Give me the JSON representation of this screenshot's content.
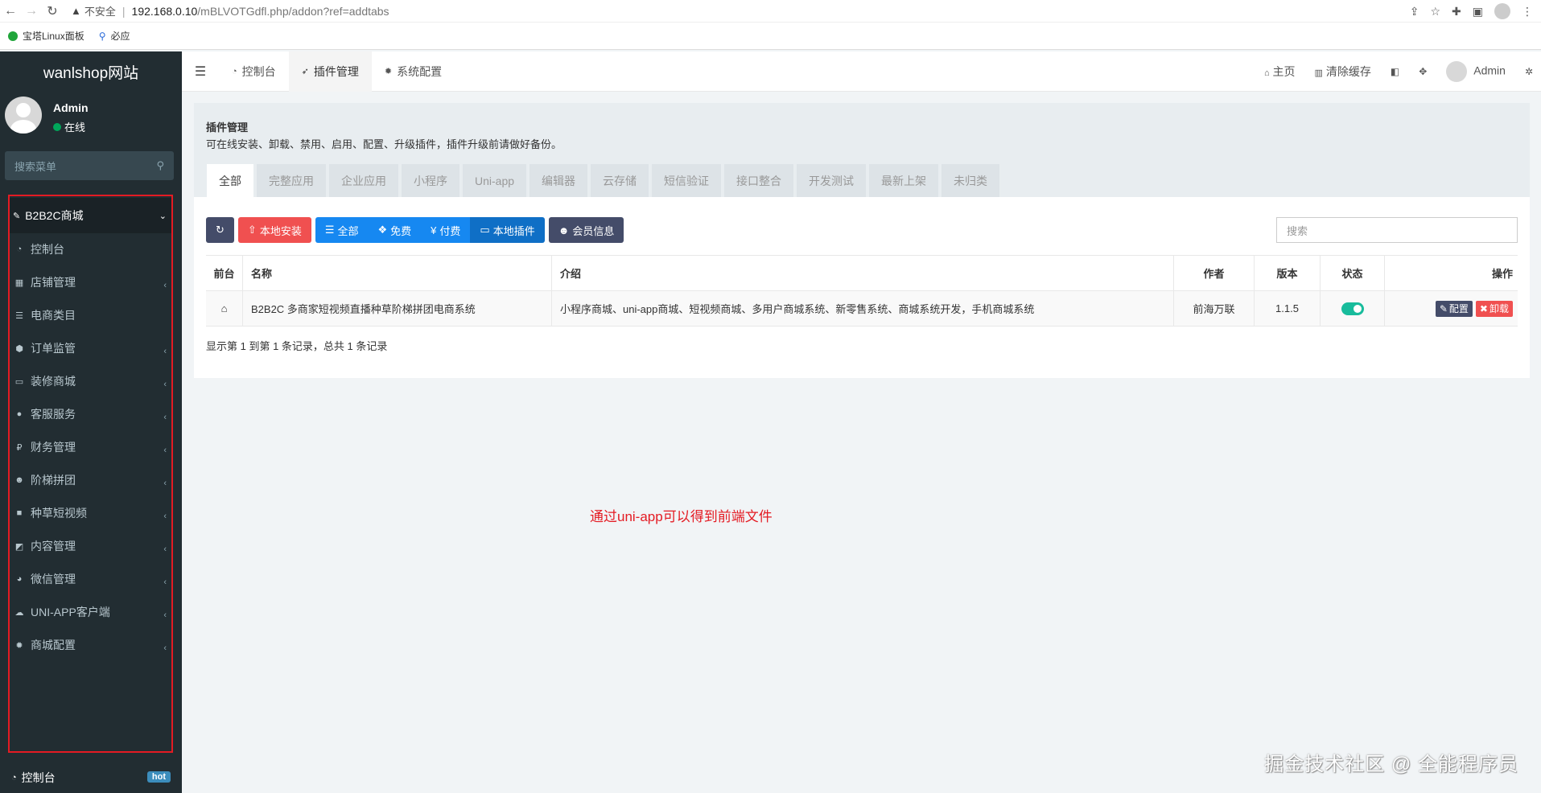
{
  "browser": {
    "back_icon": "←",
    "forward_icon": "→",
    "reload_icon": "↻",
    "warning_icon": "▲",
    "insecure_label": "不安全",
    "url_host": "192.168.0.10",
    "url_path": "/mBLVOTGdfl.php/addon?ref=addtabs",
    "bookmarks": [
      {
        "label": "宝塔Linux面板"
      },
      {
        "label": "必应"
      }
    ]
  },
  "sidebar": {
    "logo": "wanlshop网站",
    "user_name": "Admin",
    "user_status": "在线",
    "search_placeholder": "搜索菜单",
    "group_label": "B2B2C商城",
    "items": [
      {
        "label": "控制台"
      },
      {
        "label": "店铺管理"
      },
      {
        "label": "电商类目"
      },
      {
        "label": "订单监管"
      },
      {
        "label": "装修商城"
      },
      {
        "label": "客服服务"
      },
      {
        "label": "财务管理"
      },
      {
        "label": "阶梯拼团"
      },
      {
        "label": "种草短视频"
      },
      {
        "label": "内容管理"
      },
      {
        "label": "微信管理"
      },
      {
        "label": "UNI-APP客户端"
      },
      {
        "label": "商城配置"
      }
    ],
    "bottom_label": "控制台",
    "bottom_badge": "hot"
  },
  "topbar": {
    "tabs": [
      {
        "label": "控制台"
      },
      {
        "label": "插件管理"
      },
      {
        "label": "系统配置"
      }
    ],
    "home": "主页",
    "clear_cache": "清除缓存",
    "admin": "Admin"
  },
  "panel": {
    "title": "插件管理",
    "description": "可在线安装、卸载、禁用、启用、配置、升级插件，插件升级前请做好备份。",
    "categories": [
      "全部",
      "完整应用",
      "企业应用",
      "小程序",
      "Uni-app",
      "编辑器",
      "云存储",
      "短信验证",
      "接口整合",
      "开发测试",
      "最新上架",
      "未归类"
    ],
    "buttons": {
      "local_install": "本地安装",
      "all": "全部",
      "free": "免费",
      "paid": "付费",
      "local_plugins": "本地插件",
      "member_info": "会员信息"
    },
    "search_placeholder": "搜索",
    "table": {
      "headers": {
        "front": "前台",
        "name": "名称",
        "intro": "介绍",
        "author": "作者",
        "version": "版本",
        "status": "状态",
        "ops": "操作"
      },
      "rows": [
        {
          "name": "B2B2C 多商家短视频直播种草阶梯拼团电商系统",
          "intro": "小程序商城、uni-app商城、短视频商城、多用户商城系统、新零售系统、商城系统开发，手机商城系统",
          "author": "前海万联",
          "version": "1.1.5",
          "config": "配置",
          "uninstall": "卸载"
        }
      ]
    },
    "record_info": "显示第 1 到第 1 条记录，总共 1 条记录"
  },
  "annotation": "通过uni-app可以得到前端文件",
  "watermark": "掘金技术社区 @ 全能程序员",
  "colors": {
    "sidebar_bg": "#222d32",
    "annotation_red": "#e41b23",
    "toggle_on": "#18bc9c",
    "btn_red": "#f05050",
    "btn_blue": "#1688f1"
  }
}
